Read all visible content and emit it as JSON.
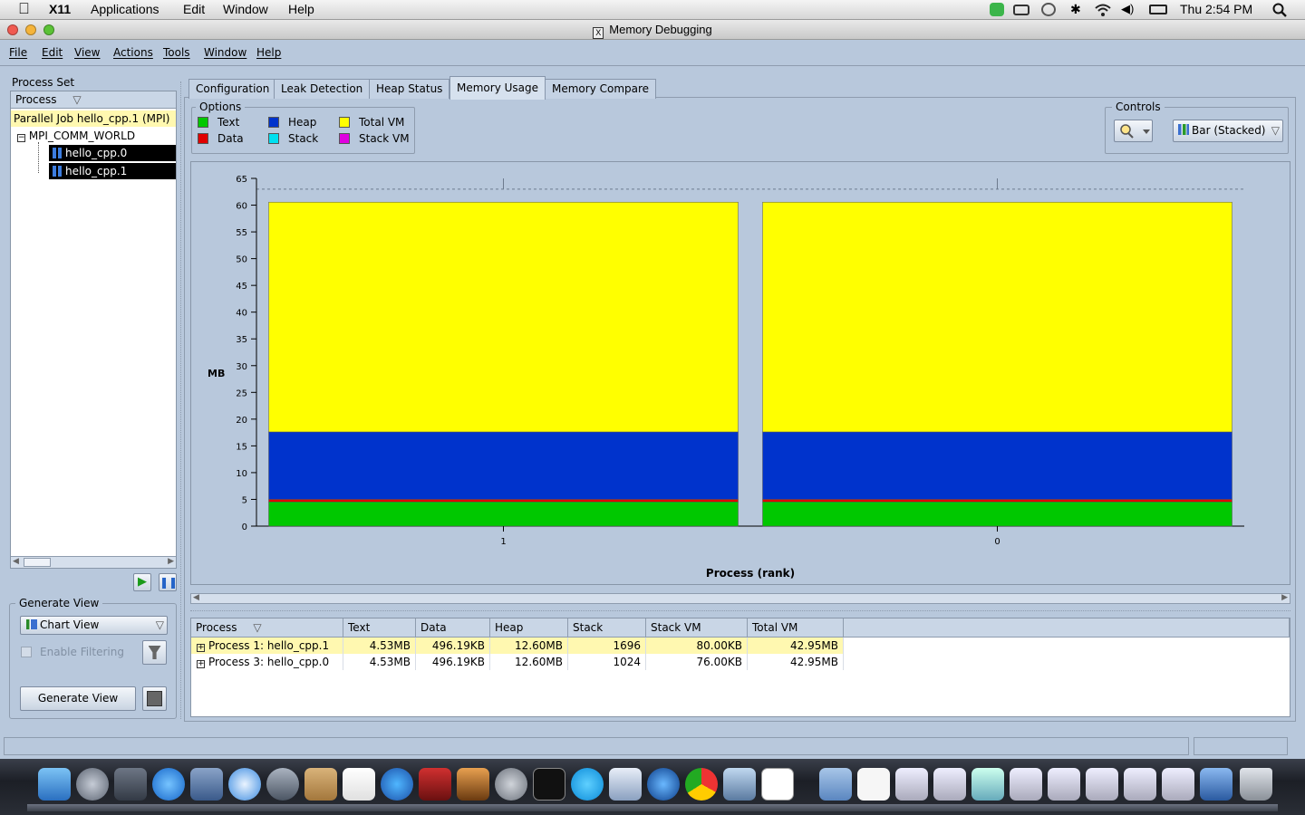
{
  "macbar": {
    "app": "X11",
    "menus": [
      "Applications",
      "Edit",
      "Window",
      "Help"
    ],
    "clock": "Thu 2:54 PM"
  },
  "window": {
    "title": "Memory Debugging"
  },
  "menubar": [
    "File",
    "Edit",
    "View",
    "Actions",
    "Tools",
    "Window",
    "Help"
  ],
  "process_set": {
    "title": "Process Set",
    "column": "Process",
    "job": "Parallel Job hello_cpp.1 (MPI)",
    "comm": "MPI_COMM_WORLD",
    "procs": [
      "hello_cpp.0",
      "hello_cpp.1"
    ]
  },
  "generate_view": {
    "title": "Generate View",
    "view_select": "Chart View",
    "filter_label": "Enable Filtering",
    "button": "Generate View"
  },
  "tabs": [
    "Configuration",
    "Leak Detection",
    "Heap Status",
    "Memory Usage",
    "Memory Compare"
  ],
  "active_tab": "Memory Usage",
  "options": {
    "title": "Options",
    "items": [
      {
        "label": "Text",
        "color": "#00c800"
      },
      {
        "label": "Heap",
        "color": "#0033cc"
      },
      {
        "label": "Total VM",
        "color": "#ffff00"
      },
      {
        "label": "Data",
        "color": "#e00000"
      },
      {
        "label": "Stack",
        "color": "#00e0f0"
      },
      {
        "label": "Stack VM",
        "color": "#e000e0"
      }
    ]
  },
  "controls": {
    "title": "Controls",
    "chart_type": "Bar (Stacked)"
  },
  "chart_data": {
    "type": "bar",
    "stacked": true,
    "categories": [
      "1",
      "0"
    ],
    "xlabel": "Process (rank)",
    "ylabel": "MB",
    "ylim": [
      0,
      65
    ],
    "yticks": [
      0,
      5,
      10,
      15,
      20,
      25,
      30,
      35,
      40,
      45,
      50,
      55,
      60,
      65
    ],
    "series": [
      {
        "name": "Text",
        "color": "#00c800",
        "values": [
          4.53,
          4.53
        ]
      },
      {
        "name": "Data",
        "color": "#e00000",
        "values": [
          0.48,
          0.48
        ]
      },
      {
        "name": "Heap",
        "color": "#0033cc",
        "values": [
          12.6,
          12.6
        ]
      },
      {
        "name": "Total VM",
        "color": "#ffff00",
        "values": [
          42.95,
          42.95
        ]
      }
    ]
  },
  "table": {
    "columns": [
      "Process",
      "Text",
      "Data",
      "Heap",
      "Stack",
      "Stack VM",
      "Total VM"
    ],
    "rows": [
      [
        "Process 1: hello_cpp.1",
        "4.53MB",
        "496.19KB",
        "12.60MB",
        "1696",
        "80.00KB",
        "42.95MB"
      ],
      [
        "Process 3: hello_cpp.0",
        "4.53MB",
        "496.19KB",
        "12.60MB",
        "1024",
        "76.00KB",
        "42.95MB"
      ]
    ]
  }
}
